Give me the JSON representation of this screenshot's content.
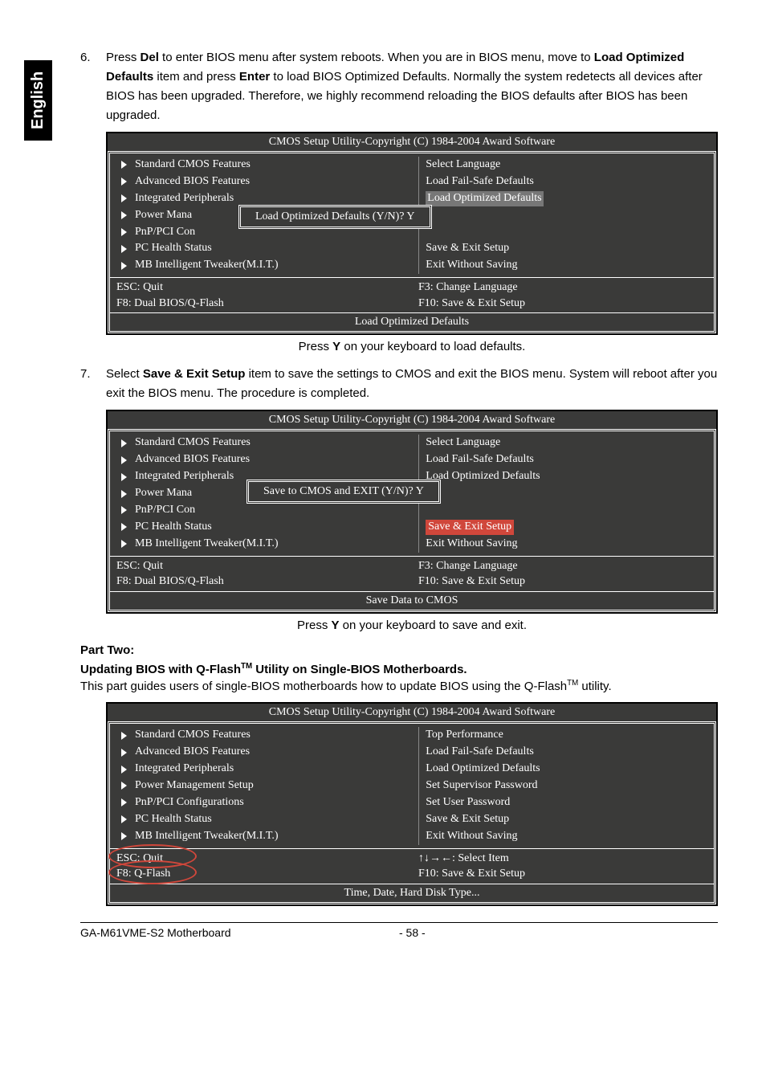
{
  "sideTab": "English",
  "step6": {
    "num": "6.",
    "text_parts": [
      "Press ",
      "Del",
      " to enter BIOS menu after system reboots. When you are in BIOS menu, move to ",
      "Load Optimized Defaults",
      " item and press ",
      "Enter",
      " to load BIOS Optimized Defaults. Normally the system redetects all devices after BIOS has been upgraded. Therefore, we highly recommend reloading the BIOS defaults after BIOS has been upgraded."
    ]
  },
  "bios1": {
    "title": "CMOS Setup Utility-Copyright (C) 1984-2004 Award Software",
    "left": [
      "Standard CMOS Features",
      "Advanced BIOS Features",
      "Integrated Peripherals",
      "Power Mana",
      "PnP/PCI Con",
      "PC Health Status",
      "MB Intelligent Tweaker(M.I.T.)"
    ],
    "right": [
      "Select Language",
      "Load Fail-Safe Defaults",
      "Load Optimized Defaults",
      "",
      "",
      "Save & Exit Setup",
      "Exit Without Saving"
    ],
    "dialog": "Load Optimized Defaults (Y/N)? Y",
    "help": {
      "l1": "ESC: Quit",
      "l2": "F8: Dual BIOS/Q-Flash",
      "r1": "F3: Change Language",
      "r2": "F10: Save & Exit Setup"
    },
    "footer": "Load Optimized Defaults"
  },
  "caption1_parts": [
    "Press ",
    "Y",
    " on your keyboard to load defaults."
  ],
  "step7": {
    "num": "7.",
    "text_parts": [
      "Select ",
      "Save & Exit Setup",
      " item to save the settings to CMOS and exit the BIOS menu. System will reboot after you exit the BIOS menu. The procedure is completed."
    ]
  },
  "bios2": {
    "title": "CMOS Setup Utility-Copyright (C) 1984-2004 Award Software",
    "left": [
      "Standard CMOS Features",
      "Advanced BIOS Features",
      "Integrated Peripherals",
      "Power Mana",
      "PnP/PCI Con",
      "PC Health Status",
      "MB Intelligent Tweaker(M.I.T.)"
    ],
    "right": [
      "Select Language",
      "Load Fail-Safe Defaults",
      "Load Optimized Defaults",
      "",
      "",
      "Save & Exit Setup",
      "Exit Without Saving"
    ],
    "dialog": "Save to CMOS and EXIT (Y/N)? Y",
    "help": {
      "l1": "ESC: Quit",
      "l2": "F8: Dual BIOS/Q-Flash",
      "r1": "F3: Change Language",
      "r2": "F10: Save & Exit Setup"
    },
    "footer": "Save Data to CMOS"
  },
  "caption2_parts": [
    "Press ",
    "Y",
    " on your keyboard to save and exit."
  ],
  "partTwo": {
    "h1": "Part Two:",
    "h2_parts": [
      "Updating BIOS with Q-Flash",
      "TM",
      " Utility on Single-BIOS Motherboards."
    ],
    "p_parts": [
      "This part guides users of single-BIOS motherboards how to update BIOS using the Q-Flash",
      "TM",
      " utility."
    ]
  },
  "bios3": {
    "title": "CMOS Setup Utility-Copyright (C) 1984-2004 Award Software",
    "left": [
      "Standard CMOS Features",
      "Advanced BIOS Features",
      "Integrated Peripherals",
      "Power Management Setup",
      "PnP/PCI Configurations",
      "PC Health Status",
      "MB Intelligent Tweaker(M.I.T.)"
    ],
    "right": [
      "Top Performance",
      "Load Fail-Safe Defaults",
      "Load Optimized Defaults",
      "Set Supervisor Password",
      "Set User Password",
      "Save & Exit Setup",
      "Exit Without Saving"
    ],
    "help": {
      "l1": "ESC: Quit",
      "l2": "F8: Q-Flash",
      "r1": "↑↓→←: Select Item",
      "r2": "F10: Save & Exit Setup"
    },
    "footer": "Time, Date, Hard Disk Type..."
  },
  "footer": {
    "left": "GA-M61VME-S2 Motherboard",
    "center": "- 58 -"
  }
}
